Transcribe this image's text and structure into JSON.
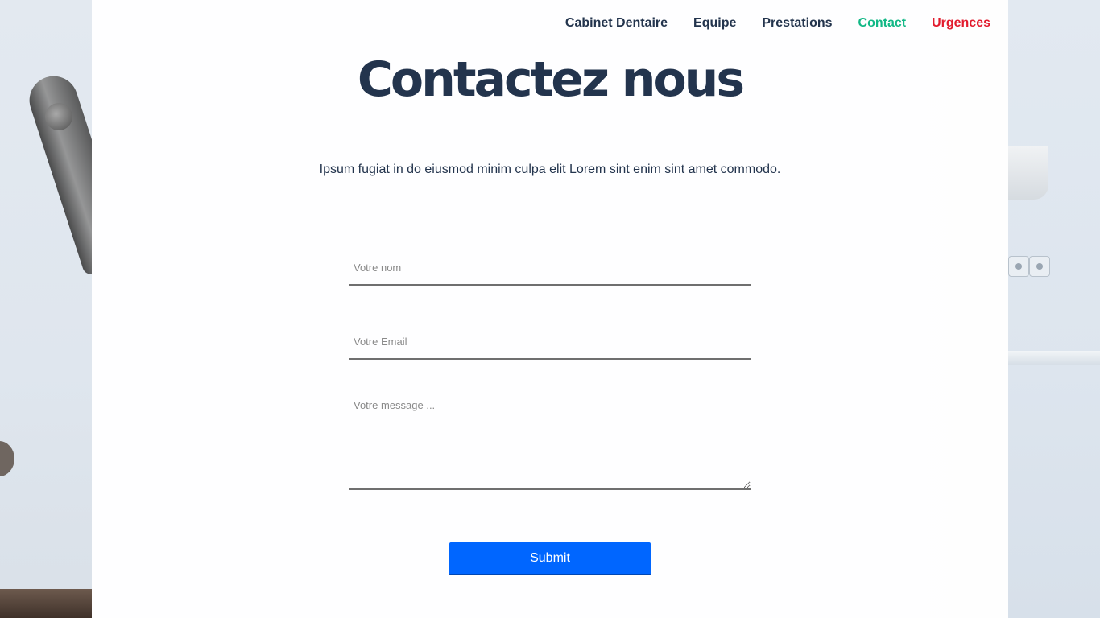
{
  "nav": {
    "items": [
      {
        "label": "Cabinet Dentaire",
        "state": "default"
      },
      {
        "label": "Equipe",
        "state": "default"
      },
      {
        "label": "Prestations",
        "state": "default"
      },
      {
        "label": "Contact",
        "state": "active"
      },
      {
        "label": "Urgences",
        "state": "urgent"
      }
    ]
  },
  "page": {
    "title": "Contactez nous",
    "intro": "Ipsum fugiat in do eiusmod minim culpa elit Lorem sint enim sint amet commodo."
  },
  "form": {
    "name_placeholder": "Votre nom",
    "email_placeholder": "Votre Email",
    "message_placeholder": "Votre message ...",
    "submit_label": "Submit"
  },
  "colors": {
    "text_dark": "#23344d",
    "active": "#12b886",
    "urgent": "#e21b2d",
    "button": "#0066ff"
  }
}
